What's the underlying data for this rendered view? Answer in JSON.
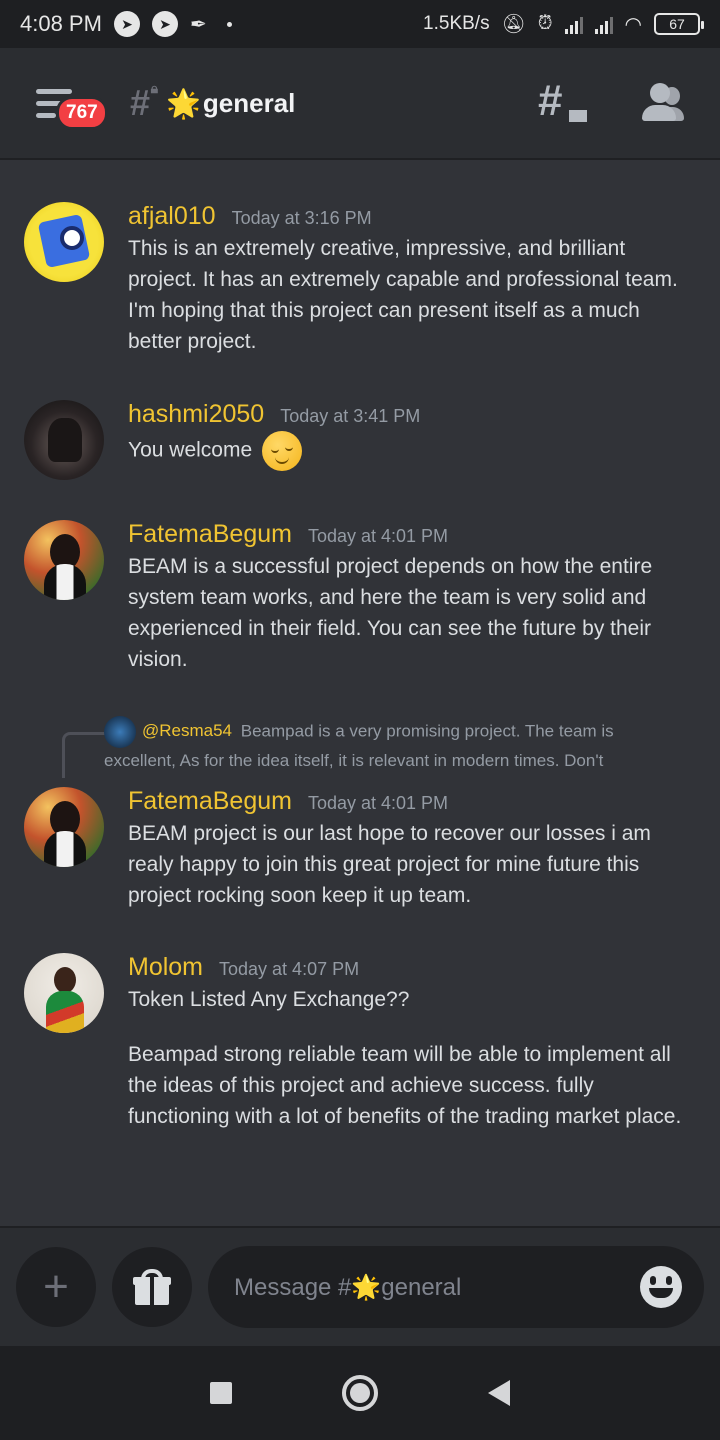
{
  "status_bar": {
    "time": "4:08 PM",
    "net_speed": "1.5KB/s",
    "battery": "67"
  },
  "header": {
    "unread_count": "767",
    "channel_name": "general",
    "channel_emoji": "🌟"
  },
  "messages": [
    {
      "username": "afjal010",
      "timestamp": "Today at 3:16 PM",
      "lines": [
        "This is an extremely creative, impressive, and brilliant project. It has an extremely capable and professional team. I'm hoping that this project can present itself as a much better project."
      ]
    },
    {
      "username": "hashmi2050",
      "timestamp": "Today at 3:41 PM",
      "lines": [
        "You welcome"
      ],
      "emoji": "relieved-face"
    },
    {
      "username": "FatemaBegum",
      "timestamp": "Today at 4:01 PM",
      "lines": [
        "BEAM is a successful project depends on how the entire system team works, and here the team is very solid and experienced in their field. You can see the future by their vision."
      ]
    },
    {
      "username": "FatemaBegum",
      "timestamp": "Today at 4:01 PM",
      "reply_to": {
        "username": "@Resma54",
        "text": "Beampad is a very promising project. The team is excellent, As for the idea itself, it is relevant in modern times. Don't"
      },
      "lines": [
        "BEAM project is our last hope to recover our losses i am realy happy to join this great project for mine future this project rocking soon keep it up team."
      ]
    },
    {
      "username": "Molom",
      "timestamp": "Today at 4:07 PM",
      "lines": [
        "Token Listed Any Exchange??",
        "Beampad strong reliable team will be able to implement all the ideas of this project and achieve success. fully functioning with a lot of benefits of the trading market place."
      ]
    }
  ],
  "composer": {
    "placeholder": "Message #🌟general"
  },
  "colors": {
    "background": "#313338",
    "username": "#f0c432",
    "badge": "#f23f43"
  }
}
